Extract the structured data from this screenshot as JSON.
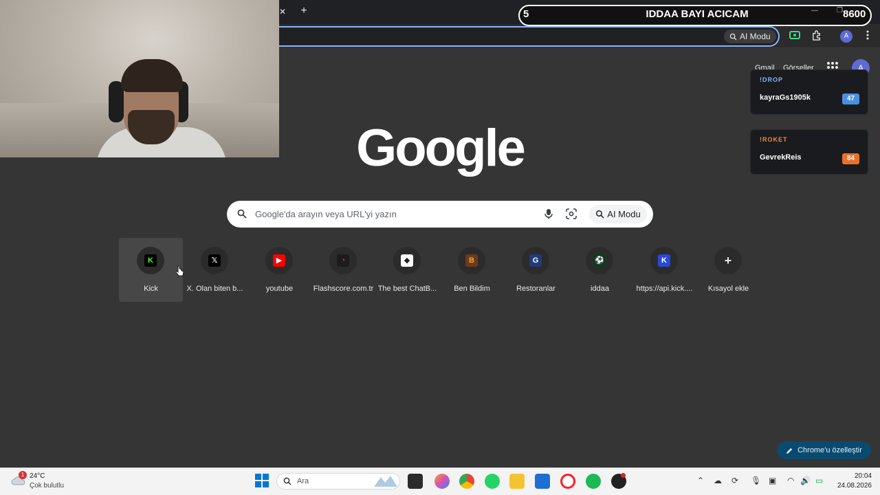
{
  "browser": {
    "tab_close": "✕",
    "new_tab": "+",
    "omnibox_ai_label": "AI Modu",
    "profile_initial": "A"
  },
  "overlay": {
    "left": "5",
    "title": "IDDAA BAYI ACICAM",
    "right": "8600"
  },
  "google_header": {
    "gmail": "Gmail",
    "images": "Görseller",
    "profile_initial": "A"
  },
  "drops": [
    {
      "label": "!DROP",
      "name": "kayraGs1905k",
      "badge": "47",
      "label_color": "#8ab4f8",
      "badge_color": "#4a90e2"
    },
    {
      "label": "!ROKET",
      "name": "GevrekReis",
      "badge": "84",
      "label_color": "#f28b30",
      "badge_color": "#e8712a"
    }
  ],
  "logo": "Google",
  "search": {
    "placeholder": "Google'da arayın veya URL'yi yazın",
    "ai_mode": "AI Modu"
  },
  "shortcuts": [
    {
      "label": "Kick",
      "fav": "K",
      "bg": "#000000",
      "fg": "#53fc18"
    },
    {
      "label": "X. Olan biten b...",
      "fav": "𝕏",
      "bg": "#000000",
      "fg": "#ffffff"
    },
    {
      "label": "youtube",
      "fav": "▶",
      "bg": "#ff0000",
      "fg": "#ffffff"
    },
    {
      "label": "Flashscore.com.tr",
      "fav": "◔",
      "bg": "#1b1b1b",
      "fg": "#ff2d55"
    },
    {
      "label": "The best ChatB...",
      "fav": "◆",
      "bg": "#ffffff",
      "fg": "#202124"
    },
    {
      "label": "Ben Bildim",
      "fav": "B",
      "bg": "#6d3a1e",
      "fg": "#f5a623"
    },
    {
      "label": "Restoranlar",
      "fav": "G",
      "bg": "#1f3b7a",
      "fg": "#ffffff"
    },
    {
      "label": "iddaa",
      "fav": "⚽",
      "bg": "#0c3d1f",
      "fg": "#3ddc84"
    },
    {
      "label": "https://api.kick....",
      "fav": "K",
      "bg": "#2748d9",
      "fg": "#ffffff"
    },
    {
      "label": "Kısayol ekle",
      "fav": "+",
      "bg": "transparent",
      "fg": "#e8eaed"
    }
  ],
  "customize": "Chrome'u özelleştir",
  "taskbar": {
    "weather_temp": "24°C",
    "weather_desc": "Çok bulutlu",
    "weather_badge": "1",
    "search_text": "Ara",
    "time": "20:04",
    "date": "24.08.2026"
  }
}
